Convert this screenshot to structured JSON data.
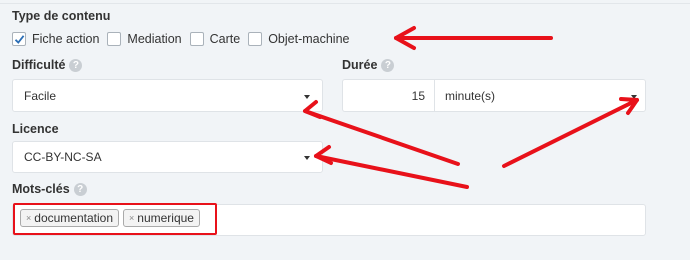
{
  "content_type": {
    "title": "Type de contenu",
    "options": [
      {
        "label": "Fiche action",
        "checked": true
      },
      {
        "label": "Mediation",
        "checked": false
      },
      {
        "label": "Carte",
        "checked": false
      },
      {
        "label": "Objet-machine",
        "checked": false
      }
    ]
  },
  "difficulty": {
    "label": "Difficulté",
    "value": "Facile"
  },
  "duration": {
    "label": "Durée",
    "amount": "15",
    "unit": "minute(s)"
  },
  "license": {
    "label": "Licence",
    "value": "CC-BY-NC-SA"
  },
  "keywords": {
    "label": "Mots-clés",
    "tags": [
      "documentation",
      "numerique"
    ]
  },
  "help_glyph": "?",
  "tag_remove_glyph": "×",
  "annotation_color": "#e8111a",
  "icons": [
    "help-icon",
    "checkmark-icon",
    "caret-down-icon",
    "tag-remove-icon",
    "red-arrow"
  ]
}
